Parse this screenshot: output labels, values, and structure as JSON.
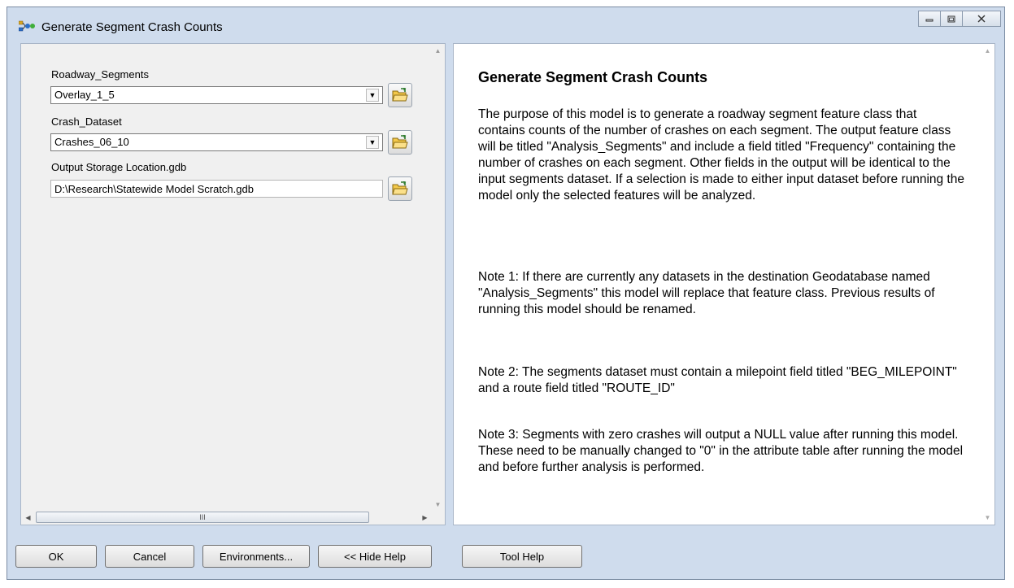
{
  "window": {
    "title": "Generate Segment Crash Counts",
    "controls": {
      "minimize": "▭",
      "maximize": "▢",
      "close": "✕"
    }
  },
  "params": [
    {
      "label": "Roadway_Segments",
      "value": "Overlay_1_5",
      "type": "combo"
    },
    {
      "label": "Crash_Dataset",
      "value": "Crashes_06_10",
      "type": "combo"
    },
    {
      "label": "Output Storage Location.gdb",
      "value": "D:\\Research\\Statewide Model Scratch.gdb",
      "type": "text"
    }
  ],
  "hscroll": {
    "thumb_grip": "III"
  },
  "help": {
    "title": "Generate Segment Crash Counts",
    "paragraphs": [
      "The purpose of this model is to generate a roadway segment feature class that contains counts of the number of crashes on each segment. The output feature class will be titled \"Analysis_Segments\" and include a field titled \"Frequency\" containing the number of crashes on each segment. Other fields in the output will be identical to the input segments dataset. If a selection is made to either input dataset before running the model only the selected features will be analyzed.",
      "Note 1: If there are currently any datasets in the destination Geodatabase named \"Analysis_Segments\" this model will replace that feature class. Previous results of running this model should be renamed.",
      "Note 2: The segments dataset must contain a milepoint field titled \"BEG_MILEPOINT\" and a route field titled \"ROUTE_ID\"",
      "Note 3: Segments with zero crashes will output a NULL value after running this model. These need to be manually changed to \"0\" in the attribute table after running the model and before further analysis is performed."
    ]
  },
  "buttons": {
    "ok": "OK",
    "cancel": "Cancel",
    "environments": "Environments...",
    "hide_help": "<< Hide Help",
    "tool_help": "Tool Help"
  },
  "icons": {
    "app": "model-icon",
    "folder": "open-folder-icon",
    "dropdown": "dropdown-arrow-icon"
  }
}
